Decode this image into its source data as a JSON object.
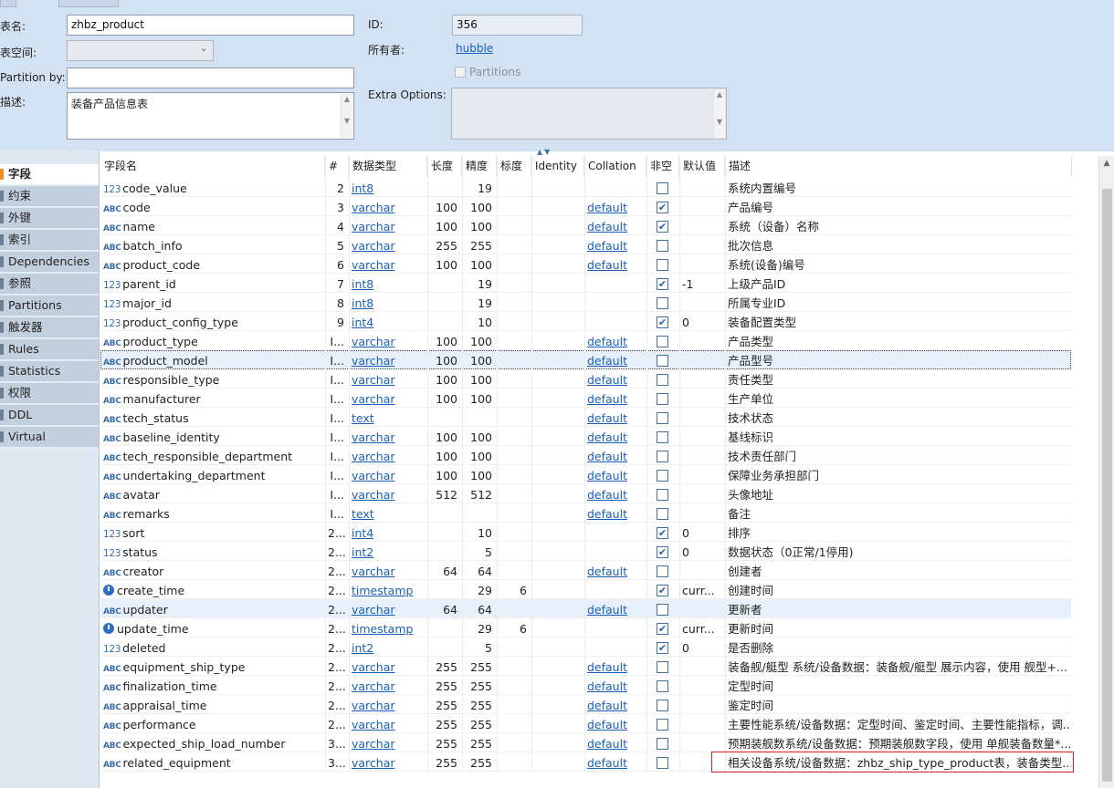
{
  "props": {
    "table_name_label": "表名:",
    "table_name_value": "zhbz_product",
    "tablespace_label": "表空间:",
    "partition_by_label": "Partition by:",
    "description_label": "描述:",
    "description_value": "装备产品信息表",
    "id_label": "ID:",
    "id_value": "356",
    "owner_label": "所有者:",
    "owner_value": "hubble",
    "partitions_label": "Partitions",
    "extra_options_label": "Extra Options:"
  },
  "sidebar": {
    "items": [
      {
        "label": "字段",
        "active": true
      },
      {
        "label": "约束"
      },
      {
        "label": "外键"
      },
      {
        "label": "索引"
      },
      {
        "label": "Dependencies"
      },
      {
        "label": "参照"
      },
      {
        "label": "Partitions"
      },
      {
        "label": "触发器"
      },
      {
        "label": "Rules"
      },
      {
        "label": "Statistics"
      },
      {
        "label": "权限"
      },
      {
        "label": "DDL"
      },
      {
        "label": "Virtual"
      }
    ]
  },
  "columns": {
    "headers": [
      "字段名",
      "#",
      "数据类型",
      "长度",
      "精度",
      "标度",
      "Identity",
      "Collation",
      "非空",
      "默认值",
      "描述"
    ],
    "rows": [
      {
        "icon": "123",
        "name": "code_value",
        "num": "2",
        "type": "int8",
        "len": "",
        "prec": "19",
        "scale": "",
        "coll": "",
        "notnull": false,
        "def": "",
        "desc": "系统内置编号"
      },
      {
        "icon": "abc",
        "name": "code",
        "num": "3",
        "type": "varchar",
        "len": "100",
        "prec": "100",
        "scale": "",
        "coll": "default",
        "notnull": true,
        "def": "",
        "desc": "产品编号"
      },
      {
        "icon": "abc",
        "name": "name",
        "num": "4",
        "type": "varchar",
        "len": "100",
        "prec": "100",
        "scale": "",
        "coll": "default",
        "notnull": true,
        "def": "",
        "desc": "系统（设备）名称"
      },
      {
        "icon": "abc",
        "name": "batch_info",
        "num": "5",
        "type": "varchar",
        "len": "255",
        "prec": "255",
        "scale": "",
        "coll": "default",
        "notnull": false,
        "def": "",
        "desc": "批次信息"
      },
      {
        "icon": "abc",
        "name": "product_code",
        "num": "6",
        "type": "varchar",
        "len": "100",
        "prec": "100",
        "scale": "",
        "coll": "default",
        "notnull": false,
        "def": "",
        "desc": "系统(设备)编号"
      },
      {
        "icon": "123",
        "name": "parent_id",
        "num": "7",
        "type": "int8",
        "len": "",
        "prec": "19",
        "scale": "",
        "coll": "",
        "notnull": true,
        "def": "-1",
        "desc": "上级产品ID"
      },
      {
        "icon": "123",
        "name": "major_id",
        "num": "8",
        "type": "int8",
        "len": "",
        "prec": "19",
        "scale": "",
        "coll": "",
        "notnull": false,
        "def": "",
        "desc": "所属专业ID"
      },
      {
        "icon": "123",
        "name": "product_config_type",
        "num": "9",
        "type": "int4",
        "len": "",
        "prec": "10",
        "scale": "",
        "coll": "",
        "notnull": true,
        "def": "0",
        "desc": "装备配置类型"
      },
      {
        "icon": "abc",
        "name": "product_type",
        "num": "I...",
        "type": "varchar",
        "len": "100",
        "prec": "100",
        "scale": "",
        "coll": "default",
        "notnull": false,
        "def": "",
        "desc": "产品类型"
      },
      {
        "icon": "abc",
        "name": "product_model",
        "num": "I...",
        "type": "varchar",
        "len": "100",
        "prec": "100",
        "scale": "",
        "coll": "default",
        "notnull": false,
        "def": "",
        "desc": "产品型号",
        "selected": true
      },
      {
        "icon": "abc",
        "name": "responsible_type",
        "num": "I...",
        "type": "varchar",
        "len": "100",
        "prec": "100",
        "scale": "",
        "coll": "default",
        "notnull": false,
        "def": "",
        "desc": "责任类型"
      },
      {
        "icon": "abc",
        "name": "manufacturer",
        "num": "I...",
        "type": "varchar",
        "len": "100",
        "prec": "100",
        "scale": "",
        "coll": "default",
        "notnull": false,
        "def": "",
        "desc": "生产单位"
      },
      {
        "icon": "abc",
        "name": "tech_status",
        "num": "I...",
        "type": "text",
        "len": "",
        "prec": "",
        "scale": "",
        "coll": "default",
        "notnull": false,
        "def": "",
        "desc": "技术状态"
      },
      {
        "icon": "abc",
        "name": "baseline_identity",
        "num": "I...",
        "type": "varchar",
        "len": "100",
        "prec": "100",
        "scale": "",
        "coll": "default",
        "notnull": false,
        "def": "",
        "desc": "基线标识"
      },
      {
        "icon": "abc",
        "name": "tech_responsible_department",
        "num": "I...",
        "type": "varchar",
        "len": "100",
        "prec": "100",
        "scale": "",
        "coll": "default",
        "notnull": false,
        "def": "",
        "desc": "技术责任部门"
      },
      {
        "icon": "abc",
        "name": "undertaking_department",
        "num": "I...",
        "type": "varchar",
        "len": "100",
        "prec": "100",
        "scale": "",
        "coll": "default",
        "notnull": false,
        "def": "",
        "desc": "保障业务承担部门"
      },
      {
        "icon": "abc",
        "name": "avatar",
        "num": "I...",
        "type": "varchar",
        "len": "512",
        "prec": "512",
        "scale": "",
        "coll": "default",
        "notnull": false,
        "def": "",
        "desc": "头像地址"
      },
      {
        "icon": "abc",
        "name": "remarks",
        "num": "I...",
        "type": "text",
        "len": "",
        "prec": "",
        "scale": "",
        "coll": "default",
        "notnull": false,
        "def": "",
        "desc": "备注"
      },
      {
        "icon": "123",
        "name": "sort",
        "num": "2...",
        "type": "int4",
        "len": "",
        "prec": "10",
        "scale": "",
        "coll": "",
        "notnull": true,
        "def": "0",
        "desc": "排序"
      },
      {
        "icon": "123",
        "name": "status",
        "num": "2...",
        "type": "int2",
        "len": "",
        "prec": "5",
        "scale": "",
        "coll": "",
        "notnull": true,
        "def": "0",
        "desc": "数据状态（0正常/1停用)"
      },
      {
        "icon": "abc",
        "name": "creator",
        "num": "2...",
        "type": "varchar",
        "len": "64",
        "prec": "64",
        "scale": "",
        "coll": "default",
        "notnull": false,
        "def": "",
        "desc": "创建者"
      },
      {
        "icon": "clock",
        "name": "create_time",
        "num": "2...",
        "type": "timestamp",
        "len": "",
        "prec": "29",
        "scale": "6",
        "coll": "",
        "notnull": true,
        "def": "curr...",
        "desc": "创建时间"
      },
      {
        "icon": "abc",
        "name": "updater",
        "num": "2...",
        "type": "varchar",
        "len": "64",
        "prec": "64",
        "scale": "",
        "coll": "default",
        "notnull": false,
        "def": "",
        "desc": "更新者",
        "hl": true
      },
      {
        "icon": "clock",
        "name": "update_time",
        "num": "2...",
        "type": "timestamp",
        "len": "",
        "prec": "29",
        "scale": "6",
        "coll": "",
        "notnull": true,
        "def": "curr...",
        "desc": "更新时间"
      },
      {
        "icon": "123",
        "name": "deleted",
        "num": "2...",
        "type": "int2",
        "len": "",
        "prec": "5",
        "scale": "",
        "coll": "",
        "notnull": true,
        "def": "0",
        "desc": "是否删除"
      },
      {
        "icon": "abc",
        "name": "equipment_ship_type",
        "num": "2...",
        "type": "varchar",
        "len": "255",
        "prec": "255",
        "scale": "",
        "coll": "default",
        "notnull": false,
        "def": "",
        "desc": "装备舰/艇型 系统/设备数据：装备舰/艇型 展示内容，使用 舰型+..."
      },
      {
        "icon": "abc",
        "name": "finalization_time",
        "num": "2...",
        "type": "varchar",
        "len": "255",
        "prec": "255",
        "scale": "",
        "coll": "default",
        "notnull": false,
        "def": "",
        "desc": "定型时间"
      },
      {
        "icon": "abc",
        "name": "appraisal_time",
        "num": "2...",
        "type": "varchar",
        "len": "255",
        "prec": "255",
        "scale": "",
        "coll": "default",
        "notnull": false,
        "def": "",
        "desc": "鉴定时间"
      },
      {
        "icon": "abc",
        "name": "performance",
        "num": "2...",
        "type": "varchar",
        "len": "255",
        "prec": "255",
        "scale": "",
        "coll": "default",
        "notnull": false,
        "def": "",
        "desc": "主要性能系统/设备数据：定型时间、鉴定时间、主要性能指标，调..."
      },
      {
        "icon": "abc",
        "name": "expected_ship_load_number",
        "num": "3...",
        "type": "varchar",
        "len": "255",
        "prec": "255",
        "scale": "",
        "coll": "default",
        "notnull": false,
        "def": "",
        "desc": "预期装舰数系统/设备数据：预期装舰数字段，使用 单舰装备数量*..."
      },
      {
        "icon": "abc",
        "name": "related_equipment",
        "num": "3...",
        "type": "varchar",
        "len": "255",
        "prec": "255",
        "scale": "",
        "coll": "default",
        "notnull": false,
        "def": "",
        "desc": "相关设备系统/设备数据：zhbz_ship_type_product表，装备类型..."
      }
    ]
  },
  "colors": {
    "panel_bg": "#d3e2f3",
    "link": "#1a5fb4",
    "selection": "#e8f1fb",
    "annotation_box": "#e02020"
  }
}
